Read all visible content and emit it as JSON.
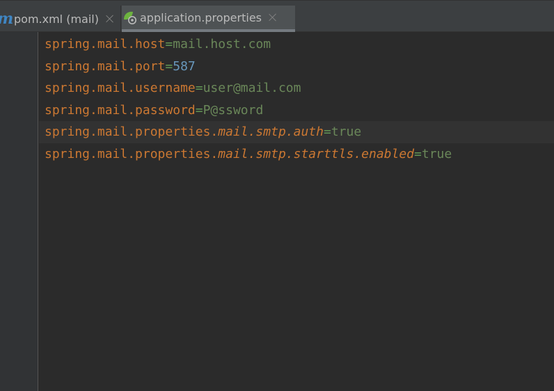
{
  "tabs": [
    {
      "label": "pom.xml (mail)",
      "icon": "maven-icon",
      "icon_glyph": "m",
      "active": false
    },
    {
      "label": "application.properties",
      "icon": "spring-properties-icon",
      "active": true
    }
  ],
  "editor": {
    "lines": [
      {
        "key": "spring.mail.host",
        "key_italic": "",
        "sep": "=",
        "value": "mail.host.com",
        "value_type": "string"
      },
      {
        "key": "spring.mail.port",
        "key_italic": "",
        "sep": "=",
        "value": "587",
        "value_type": "number"
      },
      {
        "key": "spring.mail.username",
        "key_italic": "",
        "sep": "=",
        "value": "user@mail.com",
        "value_type": "string"
      },
      {
        "key": "spring.mail.password",
        "key_italic": "",
        "sep": "=",
        "value": "P@ssword",
        "value_type": "string"
      },
      {
        "key": "spring.mail.properties.",
        "key_italic": "mail.smtp.auth",
        "sep": "=",
        "value": "true",
        "value_type": "string",
        "current": true
      },
      {
        "key": "spring.mail.properties.",
        "key_italic": "mail.smtp.starttls.enabled",
        "sep": "=",
        "value": "true",
        "value_type": "string"
      }
    ]
  },
  "colors": {
    "background": "#2b2b2b",
    "key": "#cc7832",
    "string_value": "#6a8759",
    "number_value": "#6897bb",
    "tab_bar": "#3c3f41",
    "active_tab": "#4e5254"
  }
}
